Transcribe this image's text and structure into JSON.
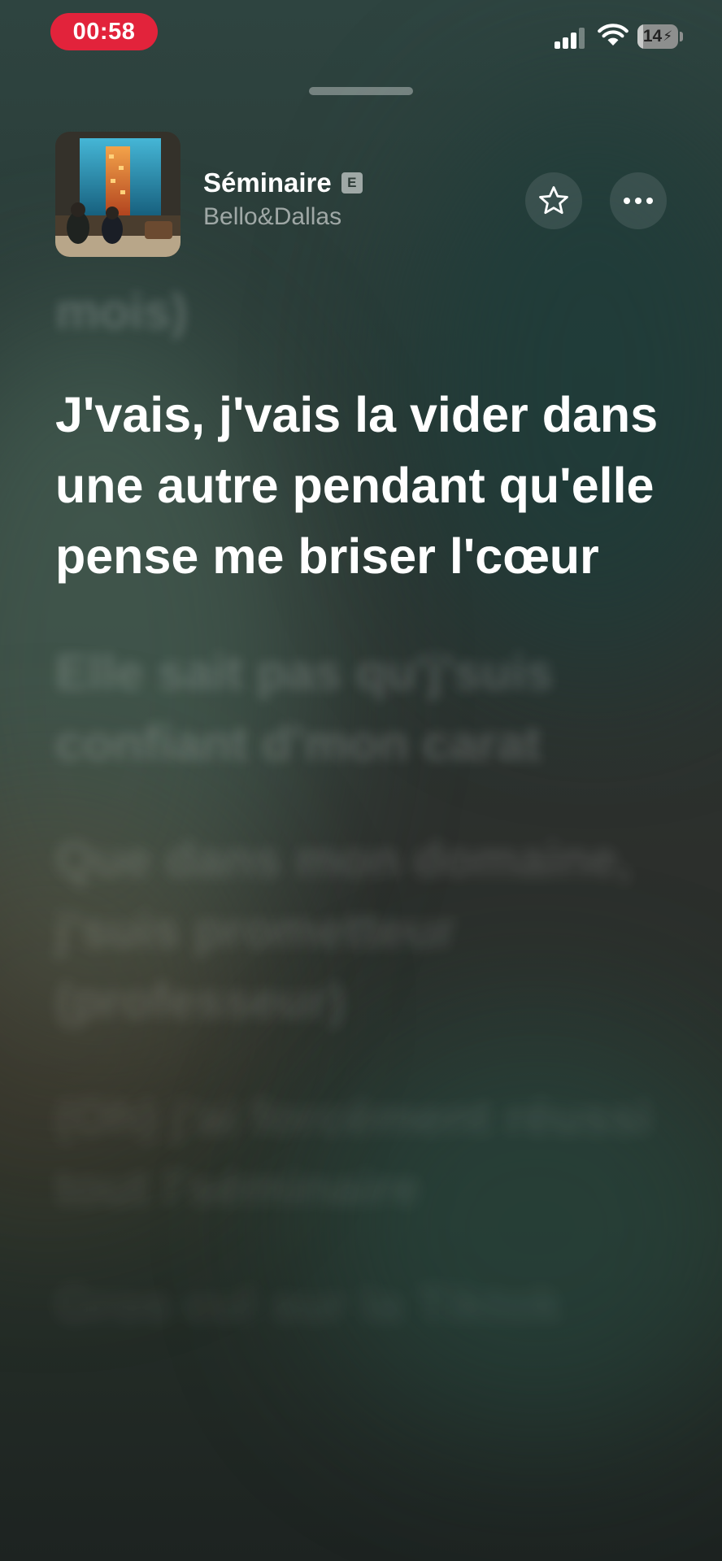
{
  "status_bar": {
    "time": "00:58",
    "battery_percent": "14",
    "battery_level": 0.14,
    "signal_bars": 3,
    "time_pill_color": "#e2233b"
  },
  "now_playing": {
    "title": "Séminaire",
    "explicit_badge": "E",
    "artist": "Bello&Dallas",
    "favorite_icon": "star-icon",
    "more_icon": "ellipsis-icon"
  },
  "lyrics": {
    "previous_line": "mois)",
    "current_line": "J'vais, j'vais la vider dans une autre pendant qu'elle pense me briser l'cœur",
    "upcoming_lines": [
      "Elle sait pas qu'j'suis confiant d'mon carat",
      "Que dans mon domaine, j'suis prometteur (professeur)",
      "(Oh) j'ai forcément réussi tout l'séminaire",
      "Gros cul sur la Tiktok"
    ]
  },
  "colors": {
    "accent": "#e2233b",
    "text_active": "#ffffff",
    "background_top": "#2e4440",
    "background_bottom": "#1d2321"
  }
}
